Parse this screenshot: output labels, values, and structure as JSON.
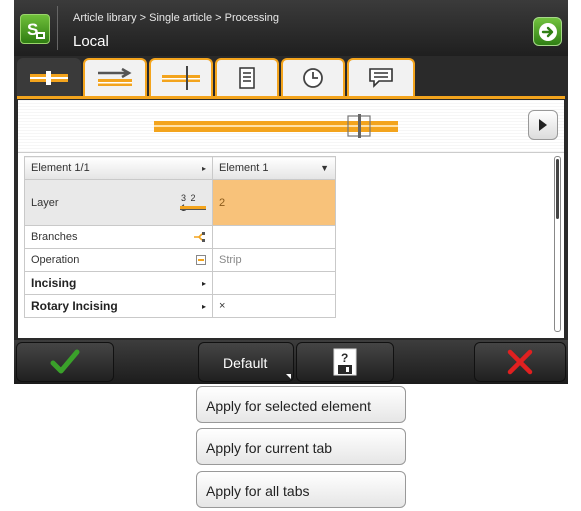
{
  "header": {
    "breadcrumb": "Article library > Single article > Processing",
    "title": "Local"
  },
  "tabs": [
    {
      "name": "profile-tab",
      "active": true
    },
    {
      "name": "feed-tab",
      "active": false
    },
    {
      "name": "cut-tab",
      "active": false
    },
    {
      "name": "list-tab",
      "active": false
    },
    {
      "name": "clock-tab",
      "active": false
    },
    {
      "name": "comment-tab",
      "active": false
    }
  ],
  "grid": {
    "header_left": "Element 1/1",
    "header_right": "Element 1",
    "rows": [
      {
        "label": "Layer",
        "icon": "layer-ruler-icon",
        "icon_text": "3 2 1",
        "value": "2"
      },
      {
        "label": "Branches",
        "icon": "branches-icon",
        "value": ""
      },
      {
        "label": "Operation",
        "icon": "operation-icon",
        "value": "Strip"
      },
      {
        "label": "Incising",
        "icon": "arrow-right-icon",
        "value": ""
      },
      {
        "label": "Rotary Incising",
        "icon": "arrow-right-icon",
        "value": "×"
      }
    ]
  },
  "bottom": {
    "default_label": "Default"
  },
  "menu": {
    "items": [
      "Apply for selected element",
      "Apply for current tab",
      "Apply for all tabs"
    ]
  },
  "colors": {
    "accent": "#f3a41d",
    "selected_cell": "#f8c27a",
    "ok_green": "#3aa12a",
    "cancel_red": "#e02020"
  }
}
